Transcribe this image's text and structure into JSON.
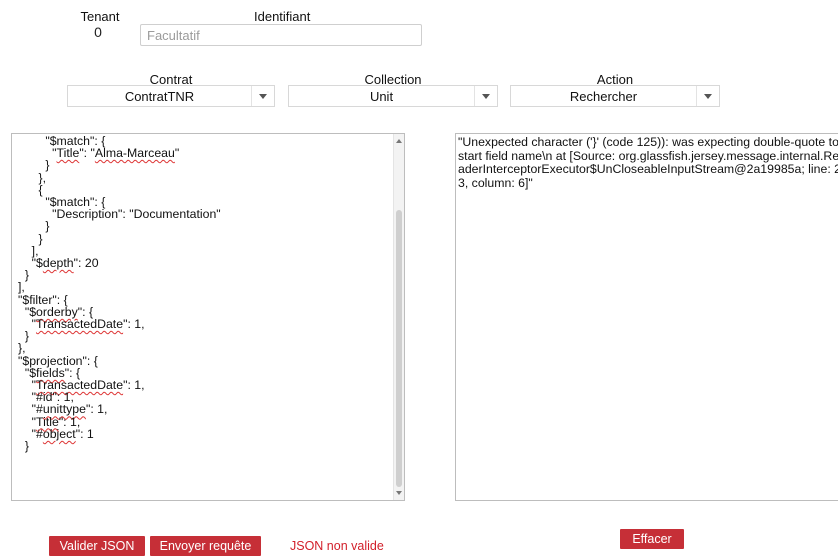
{
  "tenant": {
    "label": "Tenant",
    "value": "0"
  },
  "identifier": {
    "label": "Identifiant",
    "value": "",
    "placeholder": "Facultatif"
  },
  "selects": {
    "contract": {
      "label": "Contrat",
      "value": "ContratTNR"
    },
    "collection": {
      "label": "Collection",
      "value": "Unit"
    },
    "action": {
      "label": "Action",
      "value": "Rechercher"
    }
  },
  "request_editor": {
    "lines": [
      "        \"$match\": {",
      "          \"Title\": \"Alma-Marceau\"",
      "        }",
      "      },",
      "      {",
      "        \"$match\": {",
      "          \"Description\": \"Documentation\"",
      "        }",
      "      }",
      "    ],",
      "    \"$depth\": 20",
      "  }",
      "],",
      "\"$filter\": {",
      "  \"$orderby\": {",
      "    \"TransactedDate\": 1,",
      "  }",
      "},",
      "\"$projection\": {",
      "  \"$fields\": {",
      "    \"TransactedDate\": 1,",
      "    \"#id\": 1,",
      "    \"#unittype\": 1,",
      "    \"Title\": 1,",
      "    \"#object\": 1",
      "  }"
    ]
  },
  "response": {
    "text": "\"Unexpected character ('}' (code 125)): was expecting double-quote to start field name\\n at [Source: org.glassfish.jersey.message.internal.ReaderInterceptorExecutor$UnCloseableInputStream@2a19985a; line: 23, column: 6]\""
  },
  "buttons": {
    "validate_json": "Valider JSON",
    "send_request": "Envoyer requête",
    "clear": "Effacer"
  },
  "status": {
    "text": "JSON non valide"
  },
  "colors": {
    "button": "#c62f37",
    "status_error": "#d21f2a"
  }
}
